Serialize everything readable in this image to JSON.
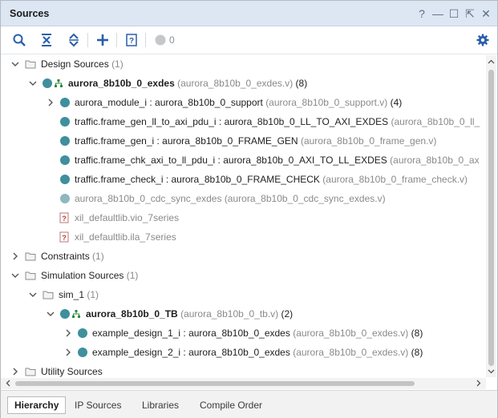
{
  "window": {
    "title": "Sources",
    "buttons": [
      "?",
      "—",
      "☐",
      "⇱",
      "✕"
    ]
  },
  "toolbar": {
    "issue_count": "0"
  },
  "tree": {
    "design_sources": {
      "label": "Design Sources",
      "count": "(1)"
    },
    "exdes": {
      "label": "aurora_8b10b_0_exdes",
      "file": "(aurora_8b10b_0_exdes.v)",
      "count": "(8)"
    },
    "module_i": {
      "label": "aurora_module_i : aurora_8b10b_0_support",
      "file": "(aurora_8b10b_0_support.v)",
      "count": "(4)"
    },
    "gen_ll": {
      "label": "traffic.frame_gen_ll_to_axi_pdu_i : aurora_8b10b_0_LL_TO_AXI_EXDES",
      "file": "(aurora_8b10b_0_ll_"
    },
    "gen_i": {
      "label": "traffic.frame_gen_i : aurora_8b10b_0_FRAME_GEN",
      "file": "(aurora_8b10b_0_frame_gen.v)"
    },
    "chk_axi": {
      "label": "traffic.frame_chk_axi_to_ll_pdu_i : aurora_8b10b_0_AXI_TO_LL_EXDES",
      "file": "(aurora_8b10b_0_ax"
    },
    "check_i": {
      "label": "traffic.frame_check_i : aurora_8b10b_0_FRAME_CHECK",
      "file": "(aurora_8b10b_0_frame_check.v)"
    },
    "cdc_sync": {
      "label": "aurora_8b10b_0_cdc_sync_exdes",
      "file": "(aurora_8b10b_0_cdc_sync_exdes.v)"
    },
    "vio": {
      "label": "xil_defaultlib.vio_7series"
    },
    "ila": {
      "label": "xil_defaultlib.ila_7series"
    },
    "constraints": {
      "label": "Constraints",
      "count": "(1)"
    },
    "simulation_sources": {
      "label": "Simulation Sources",
      "count": "(1)"
    },
    "sim_1": {
      "label": "sim_1",
      "count": "(1)"
    },
    "tb": {
      "label": "aurora_8b10b_0_TB",
      "file": "(aurora_8b10b_0_tb.v)",
      "count": "(2)"
    },
    "example1": {
      "label": "example_design_1_i : aurora_8b10b_0_exdes",
      "file": "(aurora_8b10b_0_exdes.v)",
      "count": "(8)"
    },
    "example2": {
      "label": "example_design_2_i : aurora_8b10b_0_exdes",
      "file": "(aurora_8b10b_0_exdes.v)",
      "count": "(8)"
    },
    "utility_sources": {
      "label": "Utility Sources"
    }
  },
  "tabs": [
    "Hierarchy",
    "IP Sources",
    "Libraries",
    "Compile Order"
  ],
  "colors": {
    "titlebar": "#dde6f3",
    "accent": "#2a5ea8",
    "module_dot": "#3f8f9c"
  }
}
